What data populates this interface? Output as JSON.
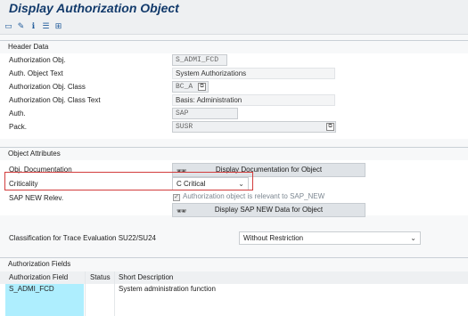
{
  "window": {
    "title": "Display Authorization Object"
  },
  "toolbar": {
    "icons": [
      "display-icon",
      "edit-icon",
      "info-icon",
      "list-icon",
      "tree-icon"
    ]
  },
  "header_data": {
    "section_title": "Header Data",
    "auth_obj_label": "Authorization Obj.",
    "auth_obj_value": "S_ADMI_FCD",
    "auth_obj_text_label": "Auth. Object Text",
    "auth_obj_text_value": "System Authorizations",
    "class_label": "Authorization Obj. Class",
    "class_value": "BC_A",
    "class_text_label": "Authorization Obj. Class Text",
    "class_text_value": "Basis: Administration",
    "auth_label": "Auth.",
    "auth_value": "SAP",
    "pack_label": "Pack.",
    "pack_value": "SUSR"
  },
  "object_attributes": {
    "section_title": "Object Attributes",
    "obj_doc_label": "Obj. Documentation",
    "display_doc_button": "Display Documentation for Object",
    "criticality_label": "Criticality",
    "criticality_value": "C Critical",
    "sap_new_label": "SAP NEW Relev.",
    "sap_new_checkbox_text": "Authorization object is relevant to SAP_NEW",
    "display_sap_new_button": "Display SAP NEW Data for Object",
    "trace_label": "Classification for Trace Evaluation SU22/SU24",
    "trace_value": "Without Restriction"
  },
  "auth_fields": {
    "section_title": "Authorization Fields",
    "columns": [
      "Authorization Field",
      "Status",
      "Short Description"
    ],
    "rows": [
      {
        "field": "S_ADMI_FCD",
        "status": "",
        "description": "System administration function"
      }
    ]
  }
}
